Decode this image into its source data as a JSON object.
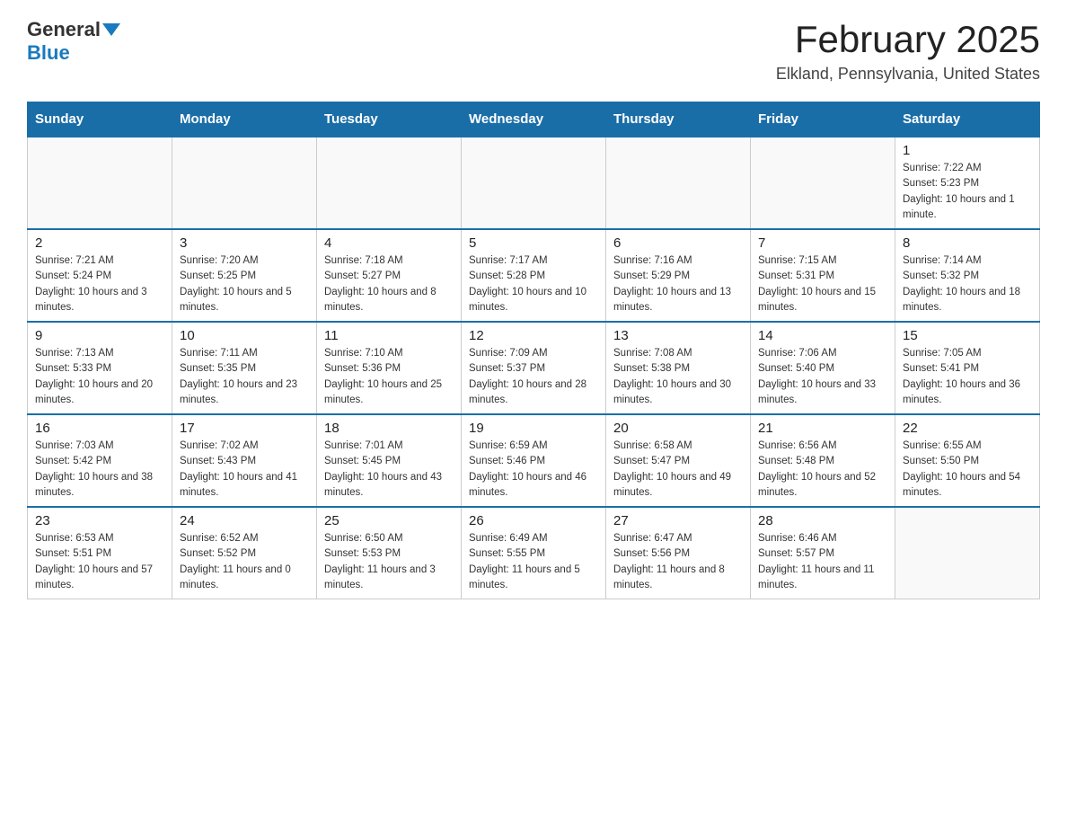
{
  "header": {
    "logo": {
      "general": "General",
      "blue": "Blue",
      "tagline": "GeneralBlue"
    },
    "title": "February 2025",
    "location": "Elkland, Pennsylvania, United States"
  },
  "weekdays": [
    "Sunday",
    "Monday",
    "Tuesday",
    "Wednesday",
    "Thursday",
    "Friday",
    "Saturday"
  ],
  "weeks": [
    [
      {
        "day": "",
        "sunrise": "",
        "sunset": "",
        "daylight": ""
      },
      {
        "day": "",
        "sunrise": "",
        "sunset": "",
        "daylight": ""
      },
      {
        "day": "",
        "sunrise": "",
        "sunset": "",
        "daylight": ""
      },
      {
        "day": "",
        "sunrise": "",
        "sunset": "",
        "daylight": ""
      },
      {
        "day": "",
        "sunrise": "",
        "sunset": "",
        "daylight": ""
      },
      {
        "day": "",
        "sunrise": "",
        "sunset": "",
        "daylight": ""
      },
      {
        "day": "1",
        "sunrise": "Sunrise: 7:22 AM",
        "sunset": "Sunset: 5:23 PM",
        "daylight": "Daylight: 10 hours and 1 minute."
      }
    ],
    [
      {
        "day": "2",
        "sunrise": "Sunrise: 7:21 AM",
        "sunset": "Sunset: 5:24 PM",
        "daylight": "Daylight: 10 hours and 3 minutes."
      },
      {
        "day": "3",
        "sunrise": "Sunrise: 7:20 AM",
        "sunset": "Sunset: 5:25 PM",
        "daylight": "Daylight: 10 hours and 5 minutes."
      },
      {
        "day": "4",
        "sunrise": "Sunrise: 7:18 AM",
        "sunset": "Sunset: 5:27 PM",
        "daylight": "Daylight: 10 hours and 8 minutes."
      },
      {
        "day": "5",
        "sunrise": "Sunrise: 7:17 AM",
        "sunset": "Sunset: 5:28 PM",
        "daylight": "Daylight: 10 hours and 10 minutes."
      },
      {
        "day": "6",
        "sunrise": "Sunrise: 7:16 AM",
        "sunset": "Sunset: 5:29 PM",
        "daylight": "Daylight: 10 hours and 13 minutes."
      },
      {
        "day": "7",
        "sunrise": "Sunrise: 7:15 AM",
        "sunset": "Sunset: 5:31 PM",
        "daylight": "Daylight: 10 hours and 15 minutes."
      },
      {
        "day": "8",
        "sunrise": "Sunrise: 7:14 AM",
        "sunset": "Sunset: 5:32 PM",
        "daylight": "Daylight: 10 hours and 18 minutes."
      }
    ],
    [
      {
        "day": "9",
        "sunrise": "Sunrise: 7:13 AM",
        "sunset": "Sunset: 5:33 PM",
        "daylight": "Daylight: 10 hours and 20 minutes."
      },
      {
        "day": "10",
        "sunrise": "Sunrise: 7:11 AM",
        "sunset": "Sunset: 5:35 PM",
        "daylight": "Daylight: 10 hours and 23 minutes."
      },
      {
        "day": "11",
        "sunrise": "Sunrise: 7:10 AM",
        "sunset": "Sunset: 5:36 PM",
        "daylight": "Daylight: 10 hours and 25 minutes."
      },
      {
        "day": "12",
        "sunrise": "Sunrise: 7:09 AM",
        "sunset": "Sunset: 5:37 PM",
        "daylight": "Daylight: 10 hours and 28 minutes."
      },
      {
        "day": "13",
        "sunrise": "Sunrise: 7:08 AM",
        "sunset": "Sunset: 5:38 PM",
        "daylight": "Daylight: 10 hours and 30 minutes."
      },
      {
        "day": "14",
        "sunrise": "Sunrise: 7:06 AM",
        "sunset": "Sunset: 5:40 PM",
        "daylight": "Daylight: 10 hours and 33 minutes."
      },
      {
        "day": "15",
        "sunrise": "Sunrise: 7:05 AM",
        "sunset": "Sunset: 5:41 PM",
        "daylight": "Daylight: 10 hours and 36 minutes."
      }
    ],
    [
      {
        "day": "16",
        "sunrise": "Sunrise: 7:03 AM",
        "sunset": "Sunset: 5:42 PM",
        "daylight": "Daylight: 10 hours and 38 minutes."
      },
      {
        "day": "17",
        "sunrise": "Sunrise: 7:02 AM",
        "sunset": "Sunset: 5:43 PM",
        "daylight": "Daylight: 10 hours and 41 minutes."
      },
      {
        "day": "18",
        "sunrise": "Sunrise: 7:01 AM",
        "sunset": "Sunset: 5:45 PM",
        "daylight": "Daylight: 10 hours and 43 minutes."
      },
      {
        "day": "19",
        "sunrise": "Sunrise: 6:59 AM",
        "sunset": "Sunset: 5:46 PM",
        "daylight": "Daylight: 10 hours and 46 minutes."
      },
      {
        "day": "20",
        "sunrise": "Sunrise: 6:58 AM",
        "sunset": "Sunset: 5:47 PM",
        "daylight": "Daylight: 10 hours and 49 minutes."
      },
      {
        "day": "21",
        "sunrise": "Sunrise: 6:56 AM",
        "sunset": "Sunset: 5:48 PM",
        "daylight": "Daylight: 10 hours and 52 minutes."
      },
      {
        "day": "22",
        "sunrise": "Sunrise: 6:55 AM",
        "sunset": "Sunset: 5:50 PM",
        "daylight": "Daylight: 10 hours and 54 minutes."
      }
    ],
    [
      {
        "day": "23",
        "sunrise": "Sunrise: 6:53 AM",
        "sunset": "Sunset: 5:51 PM",
        "daylight": "Daylight: 10 hours and 57 minutes."
      },
      {
        "day": "24",
        "sunrise": "Sunrise: 6:52 AM",
        "sunset": "Sunset: 5:52 PM",
        "daylight": "Daylight: 11 hours and 0 minutes."
      },
      {
        "day": "25",
        "sunrise": "Sunrise: 6:50 AM",
        "sunset": "Sunset: 5:53 PM",
        "daylight": "Daylight: 11 hours and 3 minutes."
      },
      {
        "day": "26",
        "sunrise": "Sunrise: 6:49 AM",
        "sunset": "Sunset: 5:55 PM",
        "daylight": "Daylight: 11 hours and 5 minutes."
      },
      {
        "day": "27",
        "sunrise": "Sunrise: 6:47 AM",
        "sunset": "Sunset: 5:56 PM",
        "daylight": "Daylight: 11 hours and 8 minutes."
      },
      {
        "day": "28",
        "sunrise": "Sunrise: 6:46 AM",
        "sunset": "Sunset: 5:57 PM",
        "daylight": "Daylight: 11 hours and 11 minutes."
      },
      {
        "day": "",
        "sunrise": "",
        "sunset": "",
        "daylight": ""
      }
    ]
  ]
}
